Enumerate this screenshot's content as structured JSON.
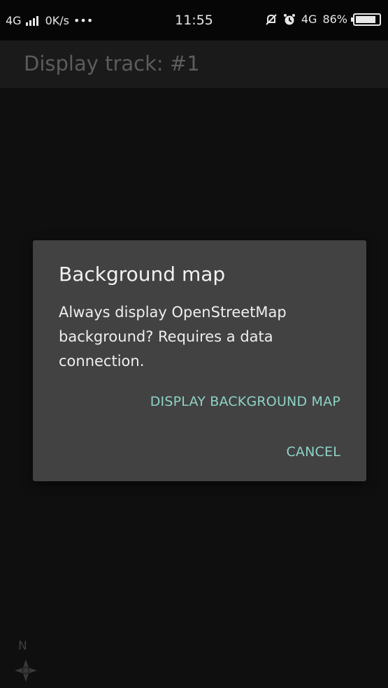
{
  "status_bar": {
    "network": "4G",
    "speed": "0K/s",
    "more": "•••",
    "time": "11:55",
    "right_network": "4G",
    "battery_percent": "86%",
    "battery_level": 0.86,
    "icons": [
      "signal-bars-icon",
      "mute-bell-icon",
      "alarm-icon",
      "battery-icon"
    ]
  },
  "app_bar": {
    "title": "Display track: #1"
  },
  "dialog": {
    "title": "Background map",
    "message": "Always display OpenStreetMap background? Requires a data connection.",
    "buttons": {
      "display": "DISPLAY BACKGROUND MAP",
      "cancel": "CANCEL"
    },
    "accent_color": "#8ed3c6"
  },
  "compass": {
    "label": "N"
  }
}
